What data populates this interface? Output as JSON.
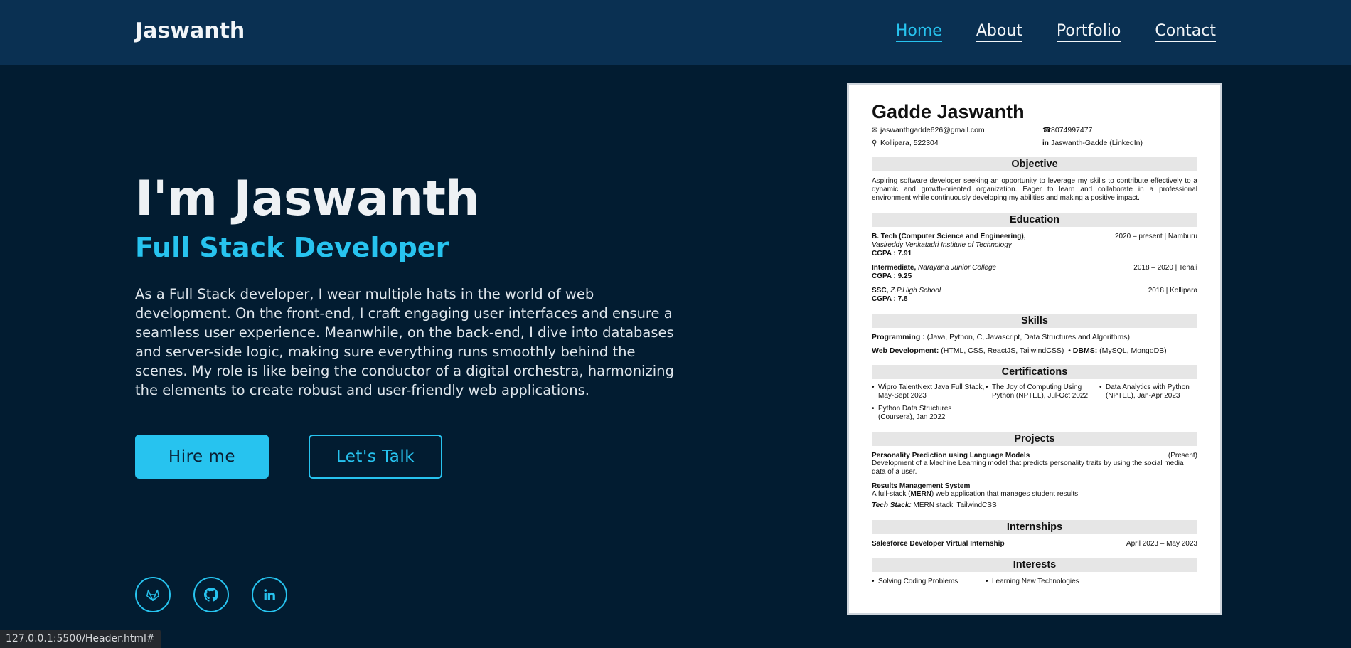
{
  "header": {
    "brand": "Jaswanth",
    "nav": [
      {
        "label": "Home",
        "active": true
      },
      {
        "label": "About"
      },
      {
        "label": "Portfolio"
      },
      {
        "label": "Contact"
      }
    ]
  },
  "hero": {
    "title": "I'm Jaswanth",
    "subtitle": "Full Stack Developer",
    "description": "As a Full Stack developer, I wear multiple hats in the world of web development. On the front-end, I craft engaging user interfaces and ensure a seamless user experience. Meanwhile, on the back-end, I dive into databases and server-side logic, making sure everything runs smoothly behind the scenes. My role is like being the conductor of a digital orchestra, harmonizing the elements to create robust and user-friendly web applications.",
    "hire_label": "Hire me",
    "talk_label": "Let's Talk"
  },
  "socials": [
    {
      "icon": "gitlab-icon"
    },
    {
      "icon": "github-icon"
    },
    {
      "icon": "linkedin-icon"
    }
  ],
  "status_url": "127.0.0.1:5500/Header.html#",
  "colors": {
    "background": "#021c31",
    "header": "#0a3052",
    "accent": "#27c3ef"
  },
  "resume": {
    "name": "Gadde Jaswanth",
    "email": "jaswanthgadde626@gmail.com",
    "phone": "8074997477",
    "location": "Kollipara, 522304",
    "linkedin": "Jaswanth-Gadde (LinkedIn)",
    "objective_title": "Objective",
    "objective": "Aspiring software developer seeking an opportunity to leverage my skills to contribute effectively to a dynamic and growth-oriented organization. Eager to learn and collaborate in a professional environment while continuously developing my abilities and making a positive impact.",
    "education_title": "Education",
    "education": [
      {
        "degree": "B. Tech (Computer Science and Engineering),",
        "institute": "Vasireddy Venkatadri Institute of Technology",
        "cgpa": "CGPA : 7.91",
        "dates": "2020 – present | Namburu"
      },
      {
        "degree": "Intermediate,",
        "institute": "Narayana Junior College",
        "cgpa": "CGPA : 9.25",
        "dates": "2018 – 2020 | Tenali"
      },
      {
        "degree": "SSC,",
        "institute": "Z.P.High School",
        "cgpa": "CGPA : 7.8",
        "dates": "2018 | Kollipara"
      }
    ],
    "skills_title": "Skills",
    "skills_prog_label": "Programming :",
    "skills_prog": "(Java, Python, C, Javascript, Data Structures and Algorithms)",
    "skills_web_label": "Web Development:",
    "skills_web": "(HTML, CSS, ReactJS, TailwindCSS)",
    "skills_db_label": "DBMS:",
    "skills_db": "(MySQL, MongoDB)",
    "cert_title": "Certifications",
    "certs": [
      "Wipro TalentNext Java Full Stack, May-Sept 2023",
      "The Joy of Computing Using Python (NPTEL), Jul-Oct 2022",
      "Data Analytics with Python (NPTEL), Jan-Apr 2023",
      "Python Data Structures (Coursera), Jan 2022"
    ],
    "projects_title": "Projects",
    "proj1_title": "Personality Prediction using Language Models",
    "proj1_status": "(Present)",
    "proj1_desc": "Development of a Machine Learning model that predicts personality traits by using the social media data of a user.",
    "proj2_title": "Results Management System",
    "proj2_desc_pre": "A full-stack (",
    "proj2_desc_bold": "MERN",
    "proj2_desc_post": ") web application that manages student results.",
    "proj2_stack_label": "Tech Stack:",
    "proj2_stack": "MERN stack, TailwindCSS",
    "intern_title": "Internships",
    "intern_name": "Salesforce Developer Virtual Internship",
    "intern_dates": "April 2023 – May 2023",
    "interests_title": "Interests",
    "interests": [
      "Solving Coding Problems",
      "Learning New Technologies"
    ]
  }
}
